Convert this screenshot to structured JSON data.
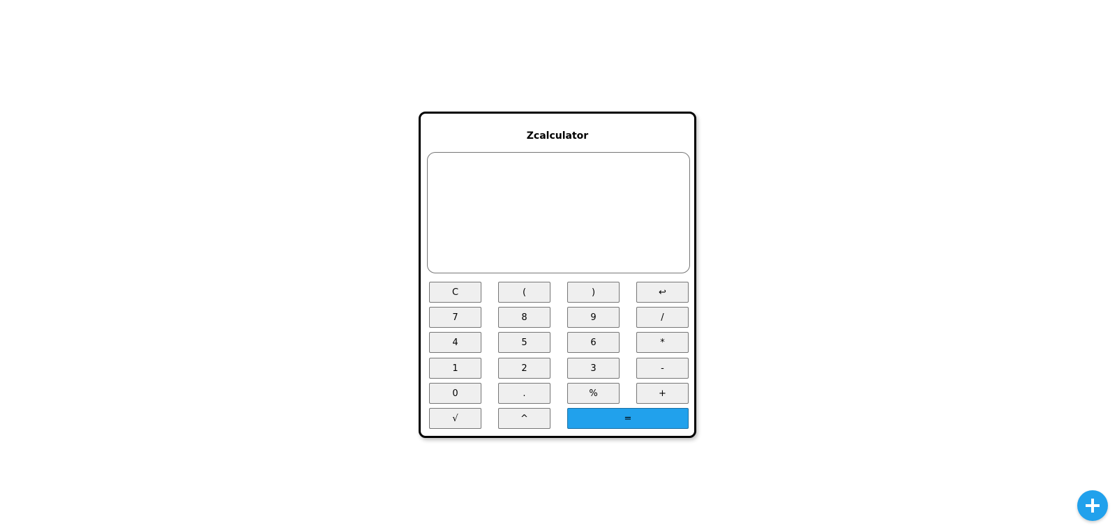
{
  "calculator": {
    "title": "Zcalculator",
    "display_value": "",
    "buttons": {
      "clear": "C",
      "open_paren": "(",
      "close_paren": ")",
      "backspace": "↩",
      "seven": "7",
      "eight": "8",
      "nine": "9",
      "divide": "/",
      "four": "4",
      "five": "5",
      "six": "6",
      "multiply": "*",
      "one": "1",
      "two": "2",
      "three": "3",
      "subtract": "-",
      "zero": "0",
      "decimal": ".",
      "percent": "%",
      "add": "+",
      "sqrt": "√",
      "power": "^",
      "equals": "="
    }
  },
  "fab": {
    "icon": "plus-icon"
  },
  "colors": {
    "accent": "#21a1ec",
    "button_bg": "#efefef",
    "border": "#000000"
  }
}
